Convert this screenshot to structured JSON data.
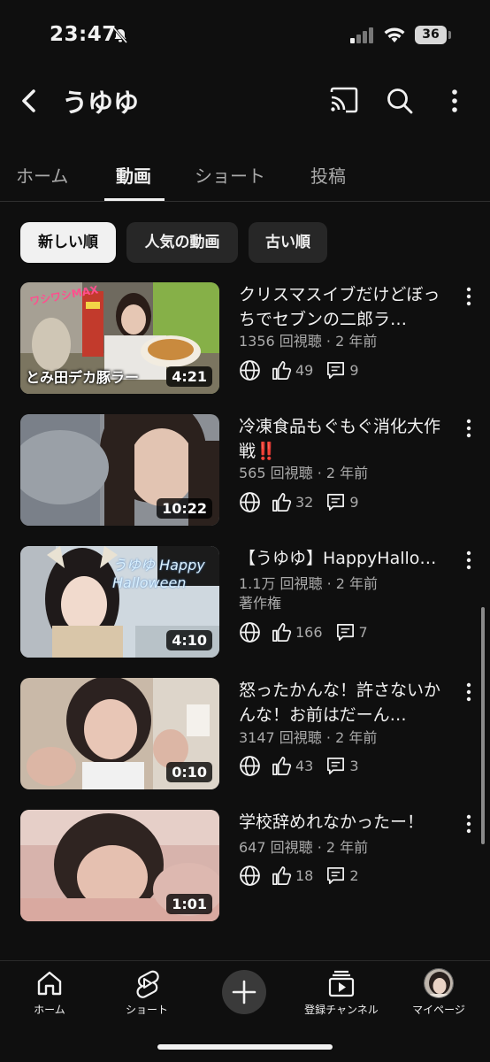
{
  "status_bar": {
    "time": "23:47",
    "battery": "36"
  },
  "header": {
    "channel_name": "うゆゆ"
  },
  "tabs": [
    {
      "label": "ホーム",
      "active": false
    },
    {
      "label": "動画",
      "active": true
    },
    {
      "label": "ショート",
      "active": false
    },
    {
      "label": "投稿",
      "active": false
    }
  ],
  "chips": [
    {
      "label": "新しい順",
      "selected": true
    },
    {
      "label": "人気の動画",
      "selected": false
    },
    {
      "label": "古い順",
      "selected": false
    }
  ],
  "videos": [
    {
      "title": "クリスマスイブだけどぼっちでセブンの二郎ラ…",
      "meta": "1356 回視聴 · 2 年前",
      "likes": "49",
      "comments": "9",
      "duration": "4:21",
      "thumb_caption": "とみ田デカ豚ラー",
      "thumb_top": "ワシワシMAX"
    },
    {
      "title": "冷凍食品もぐもぐ消化大作戦‼️",
      "meta": "565 回視聴 · 2 年前",
      "likes": "32",
      "comments": "9",
      "duration": "10:22"
    },
    {
      "title": "【うゆゆ】HappyHallo…",
      "meta": "1.1万 回視聴 · 2 年前",
      "extra": "著作権",
      "likes": "166",
      "comments": "7",
      "duration": "4:10",
      "thumb_hand": "うゆゆ Happy Halloween"
    },
    {
      "title": "怒ったかんな！許さないかんな！お前はだーん…",
      "meta": "3147 回視聴 · 2 年前",
      "likes": "43",
      "comments": "3",
      "duration": "0:10"
    },
    {
      "title": "学校辞めれなかったー！",
      "meta": "647 回視聴 · 2 年前",
      "likes": "18",
      "comments": "2",
      "duration": "1:01"
    }
  ],
  "bottom_nav": {
    "home": "ホーム",
    "shorts": "ショート",
    "subscriptions": "登録チャンネル",
    "you": "マイページ"
  }
}
